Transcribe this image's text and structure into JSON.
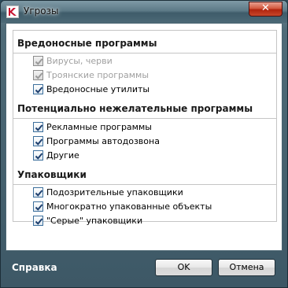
{
  "window": {
    "title": "Угрозы",
    "close_symbol": "✕"
  },
  "sections": [
    {
      "title": "Вредоносные программы",
      "items": [
        {
          "label": "Вирусы, черви",
          "checked": true,
          "enabled": false
        },
        {
          "label": "Троянские программы",
          "checked": true,
          "enabled": false
        },
        {
          "label": "Вредоносные утилиты",
          "checked": true,
          "enabled": true
        }
      ]
    },
    {
      "title": "Потенциально нежелательные программы",
      "items": [
        {
          "label": "Рекламные программы",
          "checked": true,
          "enabled": true
        },
        {
          "label": "Программы автодозвона",
          "checked": true,
          "enabled": true
        },
        {
          "label": "Другие",
          "checked": true,
          "enabled": true
        }
      ]
    },
    {
      "title": "Упаковщики",
      "items": [
        {
          "label": "Подозрительные упаковщики",
          "checked": true,
          "enabled": true
        },
        {
          "label": "Многократно упакованные объекты",
          "checked": true,
          "enabled": true
        },
        {
          "label": "\"Серые\" упаковщики",
          "checked": true,
          "enabled": true
        }
      ]
    }
  ],
  "footer": {
    "help_label": "Справка",
    "ok_label": "OK",
    "cancel_label": "Отмена"
  }
}
